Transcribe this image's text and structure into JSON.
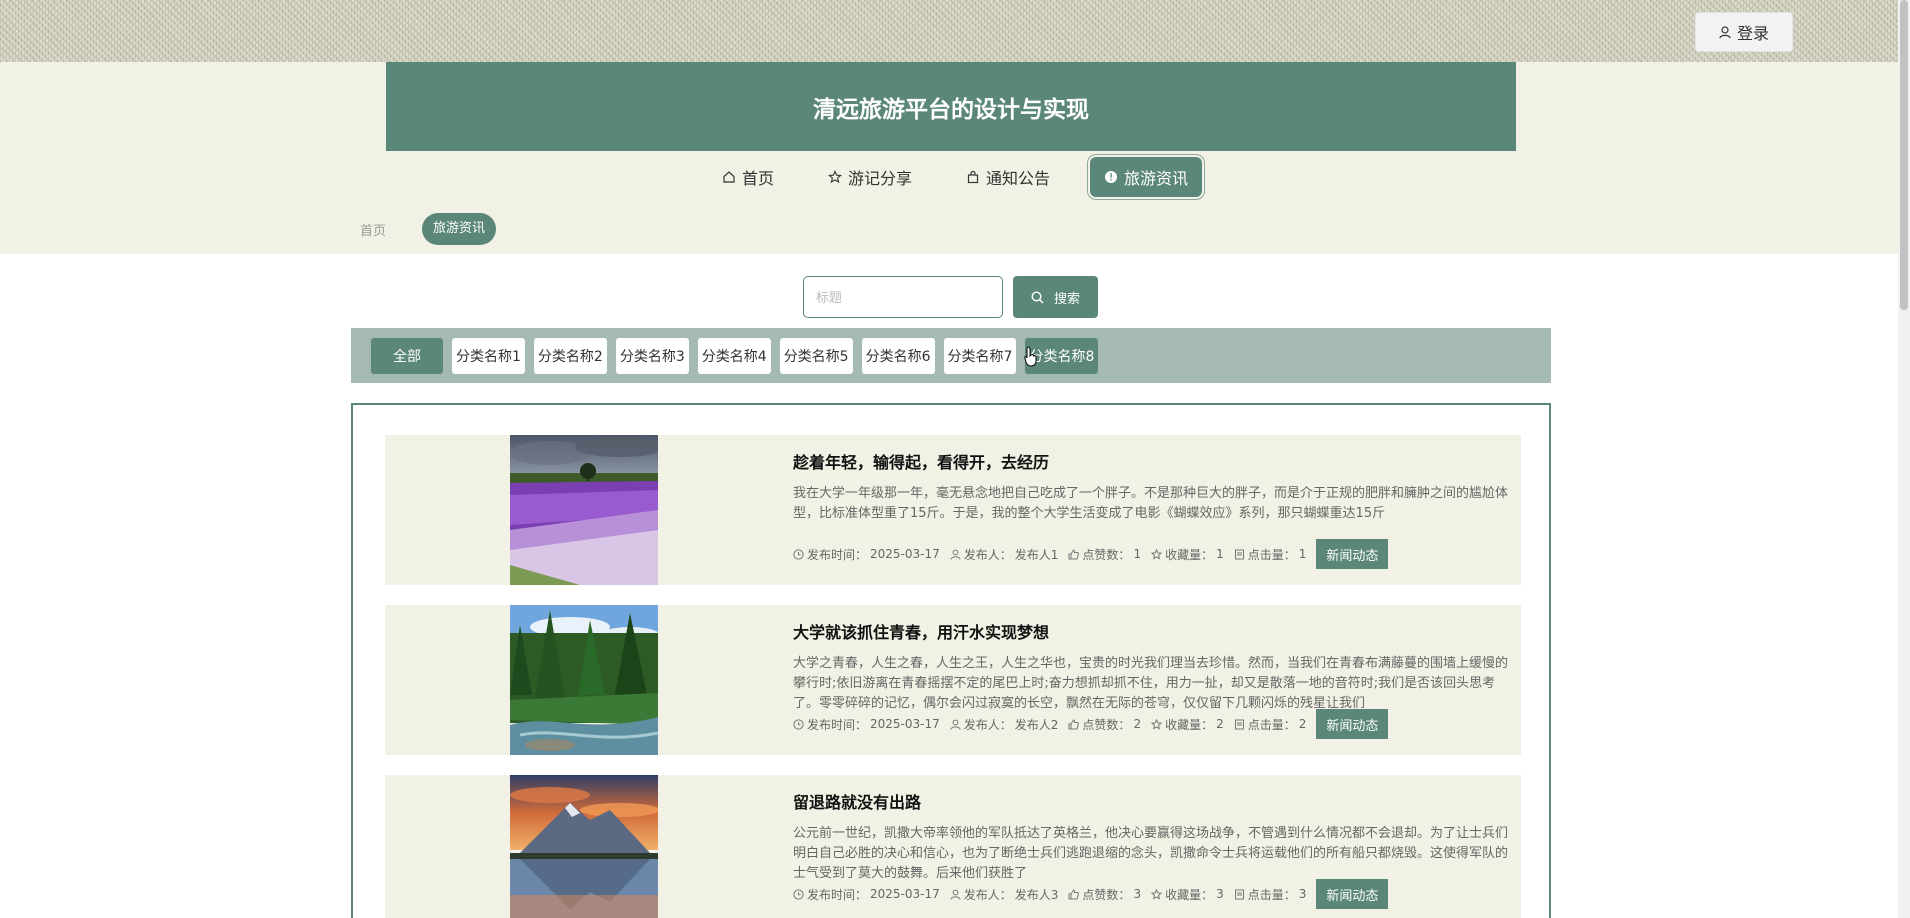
{
  "header": {
    "login_label": "登录",
    "site_title": "清远旅游平台的设计与实现"
  },
  "nav": {
    "items": [
      {
        "label": "首页",
        "icon": "home-icon"
      },
      {
        "label": "游记分享",
        "icon": "star-icon"
      },
      {
        "label": "通知公告",
        "icon": "bag-icon"
      },
      {
        "label": "旅游资讯",
        "icon": "info-icon",
        "active": true
      }
    ]
  },
  "breadcrumb": {
    "home": "首页",
    "current": "旅游资讯"
  },
  "search": {
    "placeholder": "标题",
    "button_label": "搜索"
  },
  "categories": [
    "全部",
    "分类名称1",
    "分类名称2",
    "分类名称3",
    "分类名称4",
    "分类名称5",
    "分类名称6",
    "分类名称7",
    "分类名称8"
  ],
  "meta_labels": {
    "time": "发布时间：",
    "author": "发布人：",
    "likes": "点赞数：",
    "favorites": "收藏量：",
    "clicks": "点击量："
  },
  "articles": [
    {
      "title": "趁着年轻，输得起，看得开，去经历",
      "desc": "我在大学一年级那一年，毫无悬念地把自己吃成了一个胖子。不是那种巨大的胖子，而是介于正规的肥胖和臃肿之间的尴尬体型，比标准体型重了15斤。于是，我的整个大学生活变成了电影《蝴蝶效应》系列，那只蝴蝶重达15斤",
      "date": "2025-03-17",
      "author": "发布人1",
      "likes": "1",
      "favorites": "1",
      "clicks": "1",
      "tag": "新闻动态",
      "image": "lavender-field"
    },
    {
      "title": "大学就该抓住青春，用汗水实现梦想",
      "desc": "大学之青春，人生之春，人生之王，人生之华也，宝贵的时光我们理当去珍惜。然而，当我们在青春布满藤蔓的围墙上缓慢的攀行时;依旧游离在青春摇摆不定的尾巴上时;奋力想抓却抓不住，用力一扯，却又是散落一地的音符时;我们是否该回头思考了。零零碎碎的记忆，偶尔会闪过寂寞的长空，飘然在无际的苍穹，仅仅留下几颗闪烁的残星让我们",
      "date": "2025-03-17",
      "author": "发布人2",
      "likes": "2",
      "favorites": "2",
      "clicks": "2",
      "tag": "新闻动态",
      "image": "forest-river"
    },
    {
      "title": "留退路就没有出路",
      "desc": "公元前一世纪，凯撒大帝率领他的军队抵达了英格兰，他决心要赢得这场战争，不管遇到什么情况都不会退却。为了让士兵们明白自己必胜的决心和信心，也为了断绝士兵们逃跑退缩的念头，凯撒命令士兵将运载他们的所有船只都烧毁。这使得军队的士气受到了莫大的鼓舞。后来他们获胜了",
      "date": "2025-03-17",
      "author": "发布人3",
      "likes": "3",
      "favorites": "3",
      "clicks": "3",
      "tag": "新闻动态",
      "image": "mountain-lake-sunset"
    }
  ],
  "colors": {
    "primary": "#5b877a",
    "header_bg": "#f1f1e5",
    "category_bar": "#a5bbb1"
  }
}
